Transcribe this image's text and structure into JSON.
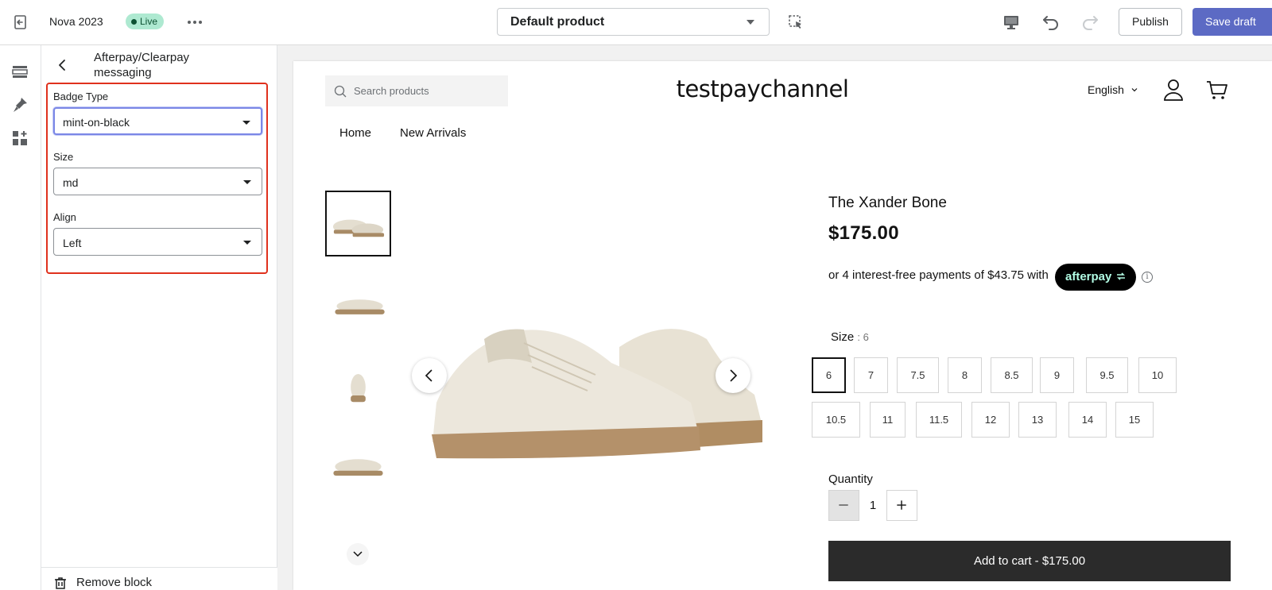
{
  "topbar": {
    "theme_name": "Nova 2023",
    "live_badge": "Live",
    "template_select": "Default product",
    "publish_label": "Publish",
    "save_label": "Save draft",
    "icons": [
      "exit-icon",
      "more-icon",
      "inspector-icon",
      "desktop-icon",
      "undo-icon",
      "redo-icon"
    ]
  },
  "rail": {
    "icons": [
      "sections-icon",
      "theme-settings-icon",
      "app-embeds-icon"
    ]
  },
  "panel": {
    "title": "Afterpay/Clearpay messaging",
    "fields": [
      {
        "label": "Badge Type",
        "value": "mint-on-black"
      },
      {
        "label": "Size",
        "value": "md"
      },
      {
        "label": "Align",
        "value": "Left"
      }
    ],
    "remove_label": "Remove block",
    "highlight_color": "#e0311d"
  },
  "store": {
    "search_placeholder": "Search products",
    "name": "testpaychannel",
    "language": "English",
    "nav": [
      "Home",
      "New Arrivals"
    ]
  },
  "product": {
    "title": "The Xander Bone",
    "price": "$175.00",
    "afterpay_text": "or 4 interest-free payments of $43.75 with",
    "afterpay_badge": "afterpay",
    "afterpay_info": "i",
    "size_label": "Size",
    "size_value": ": 6",
    "sizes": [
      "6",
      "7",
      "7.5",
      "8",
      "8.5",
      "9",
      "9.5",
      "10",
      "10.5",
      "11",
      "11.5",
      "12",
      "13",
      "14",
      "15"
    ],
    "selected_size": "6",
    "quantity_label": "Quantity",
    "quantity": "1",
    "add_to_cart": "Add to cart  -  $175.00",
    "afterpay_badge_color": "#b2fce4"
  }
}
